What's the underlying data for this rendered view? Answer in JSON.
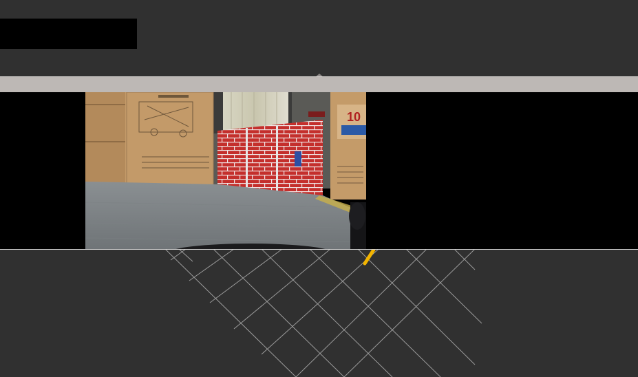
{
  "app": {
    "title": ""
  },
  "camera_panel": {
    "feed_scene": "camera-image"
  },
  "colors": {
    "background": "#303030",
    "header_bar": "#bdb8b5",
    "grid_lines": "#a9a9a9",
    "marker": "#f2b400",
    "wall_red": "#c9302e"
  }
}
